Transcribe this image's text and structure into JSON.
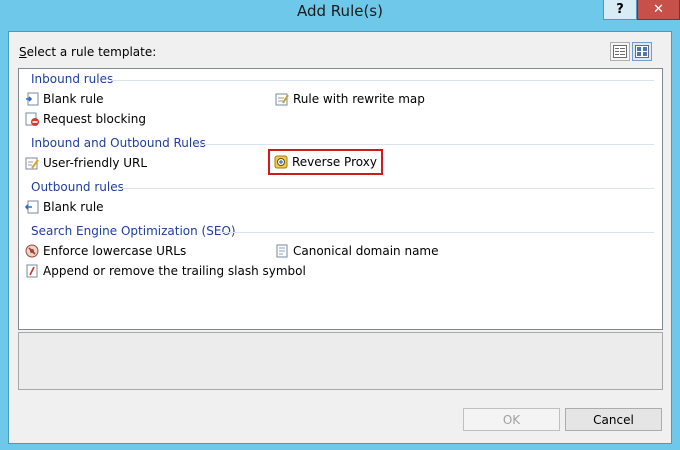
{
  "window": {
    "title": "Add Rule(s)",
    "help_glyph": "?",
    "close_glyph": "✕"
  },
  "main": {
    "select_label": "Select a rule template:",
    "view_buttons": [
      {
        "icon": "details-view-icon",
        "active": false
      },
      {
        "icon": "tiles-view-icon",
        "active": true
      }
    ],
    "groups": [
      {
        "header": "Inbound rules",
        "items": [
          {
            "label": "Blank rule",
            "icon": "blank-inbound-rule-icon"
          },
          {
            "label": "Rule with rewrite map",
            "icon": "rewrite-map-icon"
          },
          {
            "label": "Request blocking",
            "icon": "request-blocking-icon"
          }
        ]
      },
      {
        "header": "Inbound and Outbound Rules",
        "items": [
          {
            "label": "User-friendly URL",
            "icon": "user-friendly-url-icon"
          },
          {
            "label": "Reverse Proxy",
            "icon": "reverse-proxy-icon",
            "highlighted": true
          }
        ]
      },
      {
        "header": "Outbound rules",
        "items": [
          {
            "label": "Blank rule",
            "icon": "blank-outbound-rule-icon"
          }
        ]
      },
      {
        "header": "Search Engine Optimization (SEO)",
        "items": [
          {
            "label": "Enforce lowercase URLs",
            "icon": "lowercase-urls-icon"
          },
          {
            "label": "Canonical domain name",
            "icon": "canonical-domain-icon"
          },
          {
            "label": "Append or remove the trailing slash symbol",
            "icon": "trailing-slash-icon"
          }
        ]
      }
    ]
  },
  "footer": {
    "ok_label": "OK",
    "ok_enabled": false,
    "cancel_label": "Cancel"
  },
  "colors": {
    "titlebar": "#6ec8ea",
    "group_header": "#1e3f99",
    "highlight_border": "#d01b1b",
    "close_button": "#c7514a"
  }
}
